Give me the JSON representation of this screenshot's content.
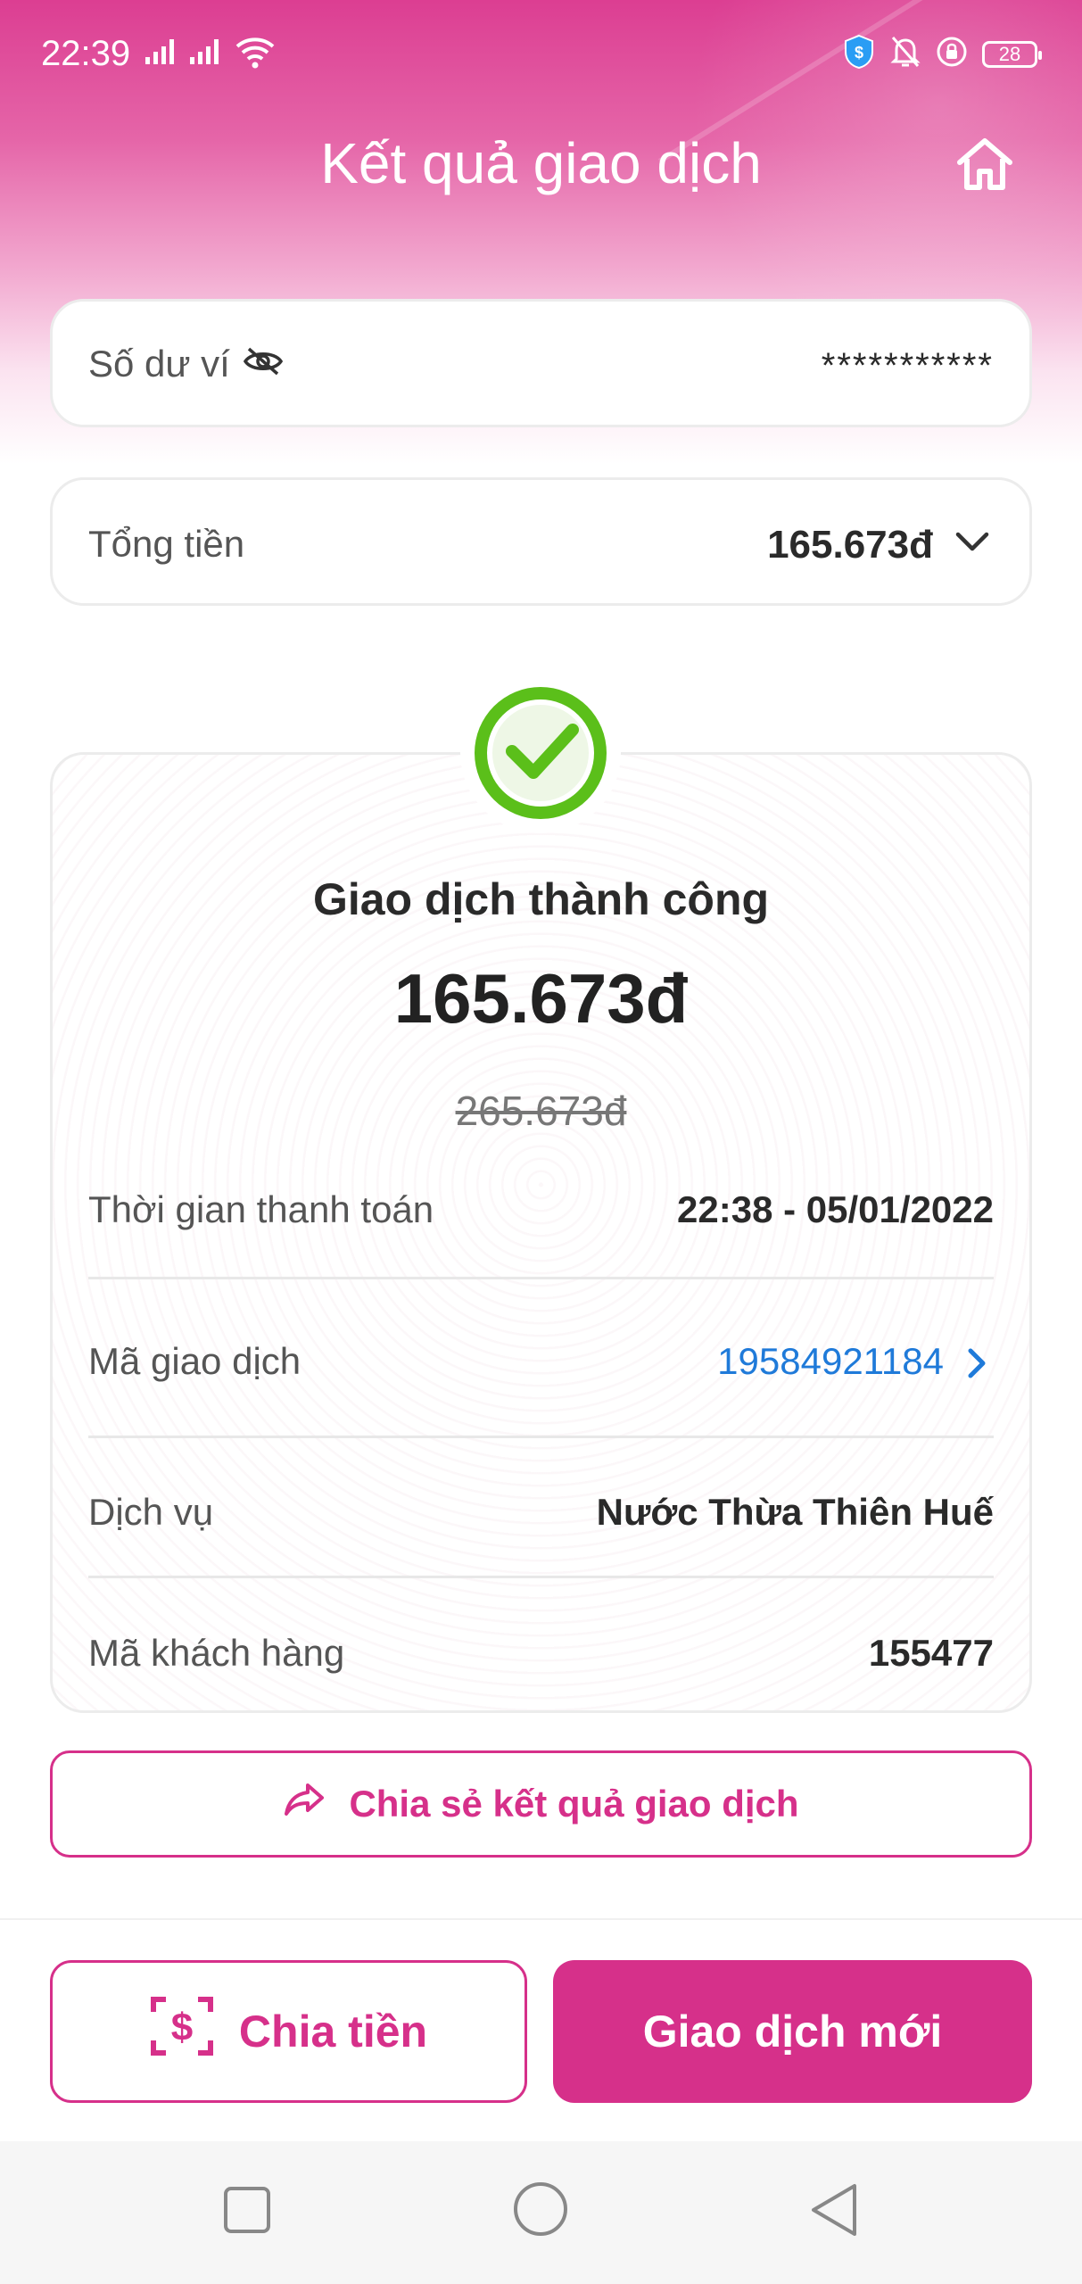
{
  "status_bar": {
    "time": "22:39",
    "battery": "28",
    "icons": [
      "signal-icon",
      "signal-icon",
      "wifi-icon",
      "shield-icon",
      "bell-off-icon",
      "lock-rotation-icon",
      "battery-icon"
    ]
  },
  "header": {
    "title": "Kết quả giao dịch",
    "home_icon": "home-icon"
  },
  "balance": {
    "label": "Số dư ví",
    "value": "***********",
    "icon": "eye-off-icon"
  },
  "total": {
    "label": "Tổng tiền",
    "value": "165.673đ",
    "icon": "chevron-down-icon"
  },
  "result": {
    "icon": "check-circle-icon",
    "title": "Giao dịch thành công",
    "amount": "165.673đ",
    "original_amount": "265.673đ",
    "details": [
      {
        "label": "Thời gian thanh toán",
        "value": "22:38 - 05/01/2022"
      },
      {
        "label": "Mã giao dịch",
        "value": "19584921184"
      },
      {
        "label": "Dịch vụ",
        "value": "Nước Thừa Thiên Huế"
      },
      {
        "label": "Mã khách hàng",
        "value": "155477"
      }
    ]
  },
  "actions": {
    "share_label": "Chia sẻ kết quả giao dịch",
    "split_label": "Chia tiền",
    "new_label": "Giao dịch mới"
  },
  "colors": {
    "brand": "#d6308a",
    "success": "#5bbf1a",
    "link": "#1f7ad9"
  }
}
